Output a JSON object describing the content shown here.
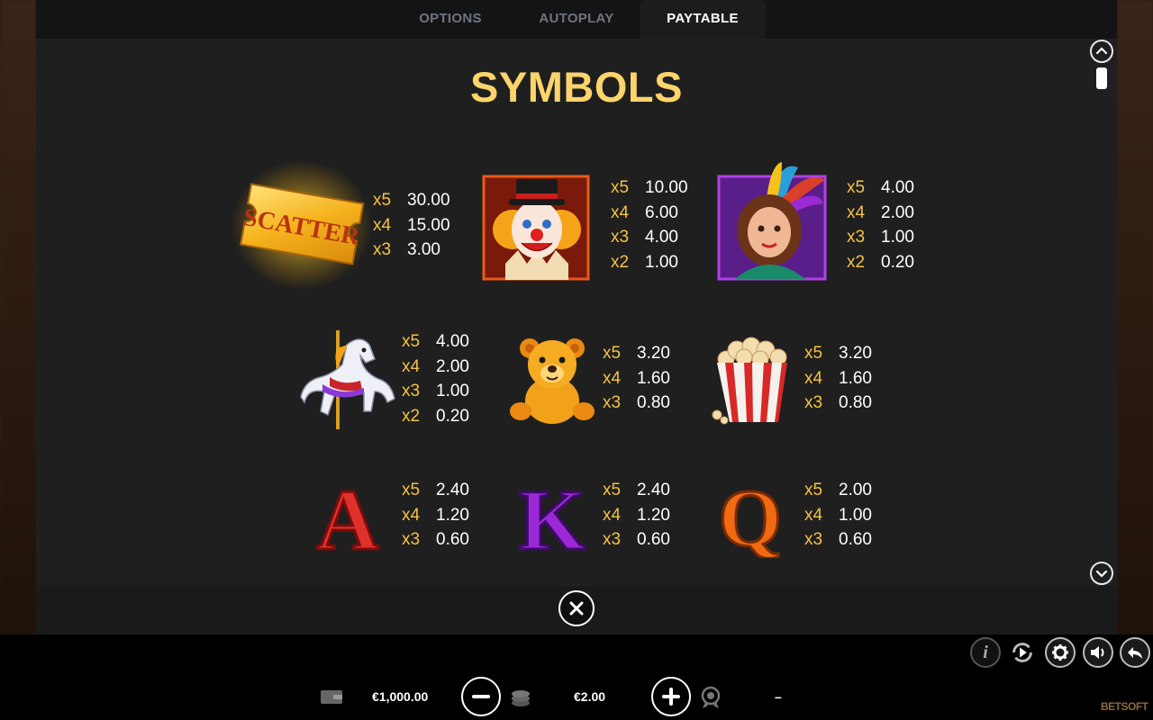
{
  "tabs": [
    {
      "label": "OPTIONS",
      "active": false
    },
    {
      "label": "AUTOPLAY",
      "active": false
    },
    {
      "label": "PAYTABLE",
      "active": true
    }
  ],
  "paytable": {
    "title": "SYMBOLS",
    "symbols": [
      {
        "name": "scatter",
        "icon": "scatter-ticket-icon",
        "label": "SCATTER",
        "pays": [
          [
            "x5",
            "30.00"
          ],
          [
            "x4",
            "15.00"
          ],
          [
            "x3",
            "3.00"
          ]
        ]
      },
      {
        "name": "clown",
        "icon": "clown-icon",
        "pays": [
          [
            "x5",
            "10.00"
          ],
          [
            "x4",
            "6.00"
          ],
          [
            "x3",
            "4.00"
          ],
          [
            "x2",
            "1.00"
          ]
        ]
      },
      {
        "name": "showgirl",
        "icon": "showgirl-icon",
        "pays": [
          [
            "x5",
            "4.00"
          ],
          [
            "x4",
            "2.00"
          ],
          [
            "x3",
            "1.00"
          ],
          [
            "x2",
            "0.20"
          ]
        ]
      },
      {
        "name": "carousel-horse",
        "icon": "carousel-horse-icon",
        "pays": [
          [
            "x5",
            "4.00"
          ],
          [
            "x4",
            "2.00"
          ],
          [
            "x3",
            "1.00"
          ],
          [
            "x2",
            "0.20"
          ]
        ]
      },
      {
        "name": "teddy-bear",
        "icon": "teddy-bear-icon",
        "pays": [
          [
            "x5",
            "3.20"
          ],
          [
            "x4",
            "1.60"
          ],
          [
            "x3",
            "0.80"
          ]
        ]
      },
      {
        "name": "popcorn",
        "icon": "popcorn-icon",
        "pays": [
          [
            "x5",
            "3.20"
          ],
          [
            "x4",
            "1.60"
          ],
          [
            "x3",
            "0.80"
          ]
        ]
      },
      {
        "name": "ace",
        "icon": "letter-a-icon",
        "letter": "A",
        "color": "#e0302a",
        "pays": [
          [
            "x5",
            "2.40"
          ],
          [
            "x4",
            "1.20"
          ],
          [
            "x3",
            "0.60"
          ]
        ]
      },
      {
        "name": "king",
        "icon": "letter-k-icon",
        "letter": "K",
        "color": "#9b2ad6",
        "pays": [
          [
            "x5",
            "2.40"
          ],
          [
            "x4",
            "1.20"
          ],
          [
            "x3",
            "0.60"
          ]
        ]
      },
      {
        "name": "queen",
        "icon": "letter-q-icon",
        "letter": "Q",
        "color": "#ef6a12",
        "pays": [
          [
            "x5",
            "2.00"
          ],
          [
            "x4",
            "1.00"
          ],
          [
            "x3",
            "0.60"
          ]
        ]
      }
    ]
  },
  "controls": {
    "balance": "€1,000.00",
    "bet": "€2.00",
    "win": "–",
    "brand": "BETSOFT"
  },
  "icons": {
    "scroll_up": "chevron-up-icon",
    "scroll_down": "chevron-down-icon",
    "close": "close-icon",
    "wallet": "wallet-icon",
    "coins": "coins-icon",
    "win": "win-badge-icon",
    "info": "info-icon",
    "autoplay": "autoplay-icon",
    "settings": "gear-icon",
    "sound": "speaker-icon",
    "back": "back-arrow-icon"
  },
  "colors": {
    "title": "#fdd46b",
    "multiplier": "#f5c342",
    "value": "#ffffff"
  }
}
